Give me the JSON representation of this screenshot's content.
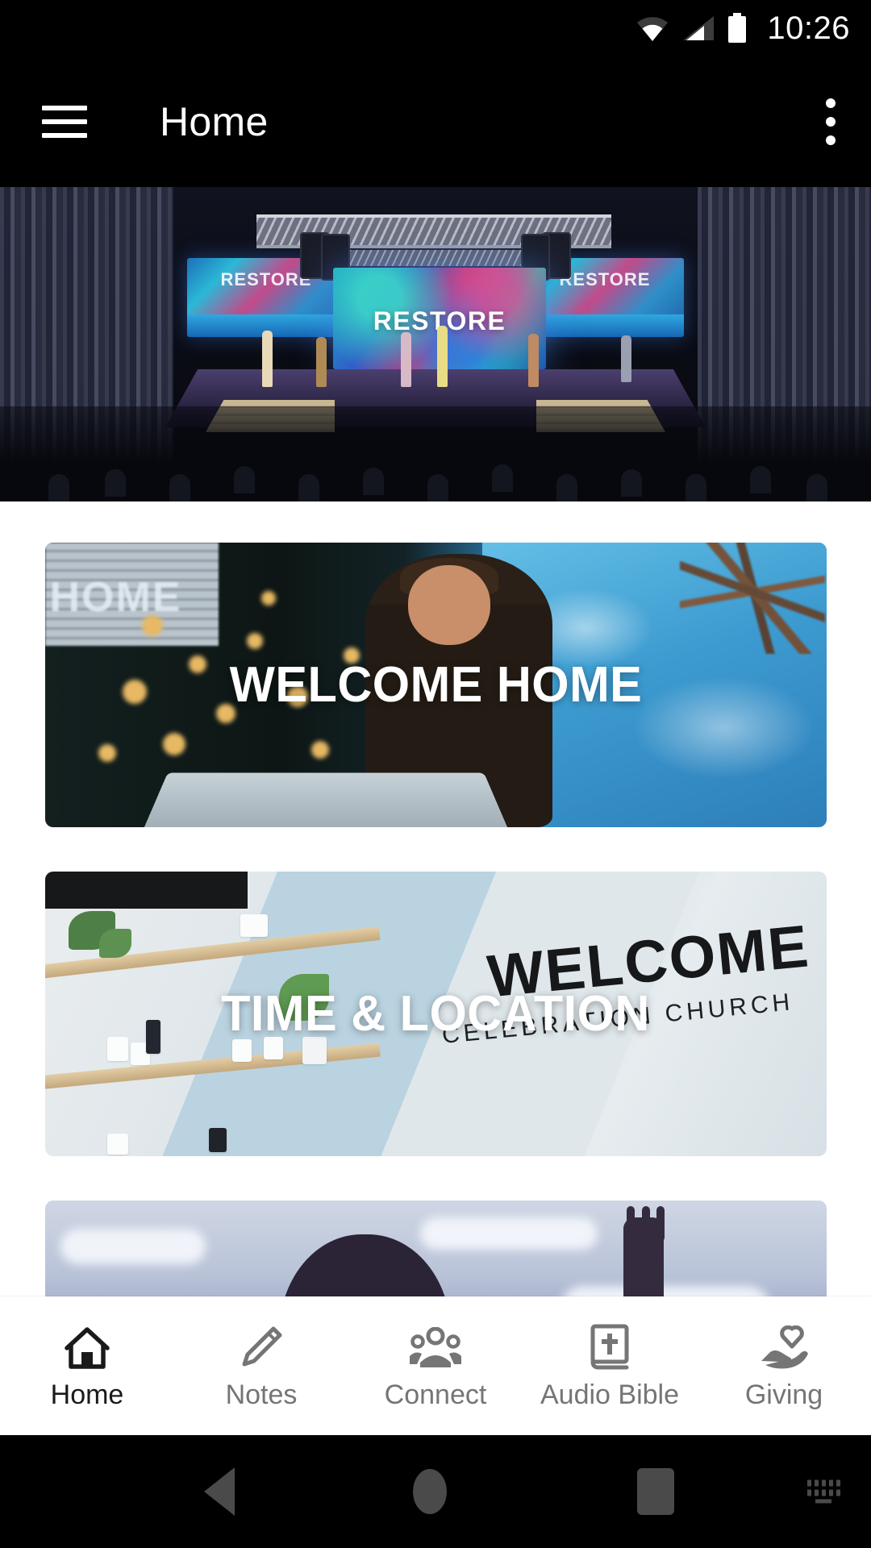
{
  "status_bar": {
    "time": "10:26",
    "icons": [
      "wifi-icon",
      "cellular-signal-icon",
      "battery-icon"
    ]
  },
  "app_bar": {
    "menu_icon": "hamburger-menu-icon",
    "title": "Home",
    "overflow_icon": "more-vertical-icon"
  },
  "hero": {
    "type": "image-banner",
    "alt": "Church worship service on stage",
    "screen_text": "RESTORE",
    "side_screen_text": "RESTORE"
  },
  "cards": [
    {
      "label": "WELCOME HOME",
      "alt": "Pastor speaking at podium with bokeh lights and tropical sky backdrop",
      "sign_text": "HOME"
    },
    {
      "label": "TIME & LOCATION",
      "alt": "Church lobby with shelves and WELCOME wall sign",
      "wall_sign": "WELCOME",
      "wall_subtext": "CELEBRATION CHURCH"
    },
    {
      "label": "",
      "alt": "Silhouette of person with raised hand against sky"
    }
  ],
  "bottom_nav": {
    "active_index": 0,
    "items": [
      {
        "label": "Home",
        "icon": "home-icon"
      },
      {
        "label": "Notes",
        "icon": "pencil-icon"
      },
      {
        "label": "Connect",
        "icon": "people-group-icon"
      },
      {
        "label": "Audio Bible",
        "icon": "bible-cross-icon"
      },
      {
        "label": "Giving",
        "icon": "hand-heart-icon"
      }
    ]
  },
  "android_nav": {
    "back": "back-triangle-icon",
    "home": "home-circle-icon",
    "recents": "recents-square-icon",
    "keyboard": "keyboard-icon"
  },
  "colors": {
    "app_bar_bg": "#000000",
    "page_bg": "#ffffff",
    "nav_active": "#1a1a1a",
    "nav_inactive": "#757575",
    "android_nav_bg": "#000000"
  }
}
